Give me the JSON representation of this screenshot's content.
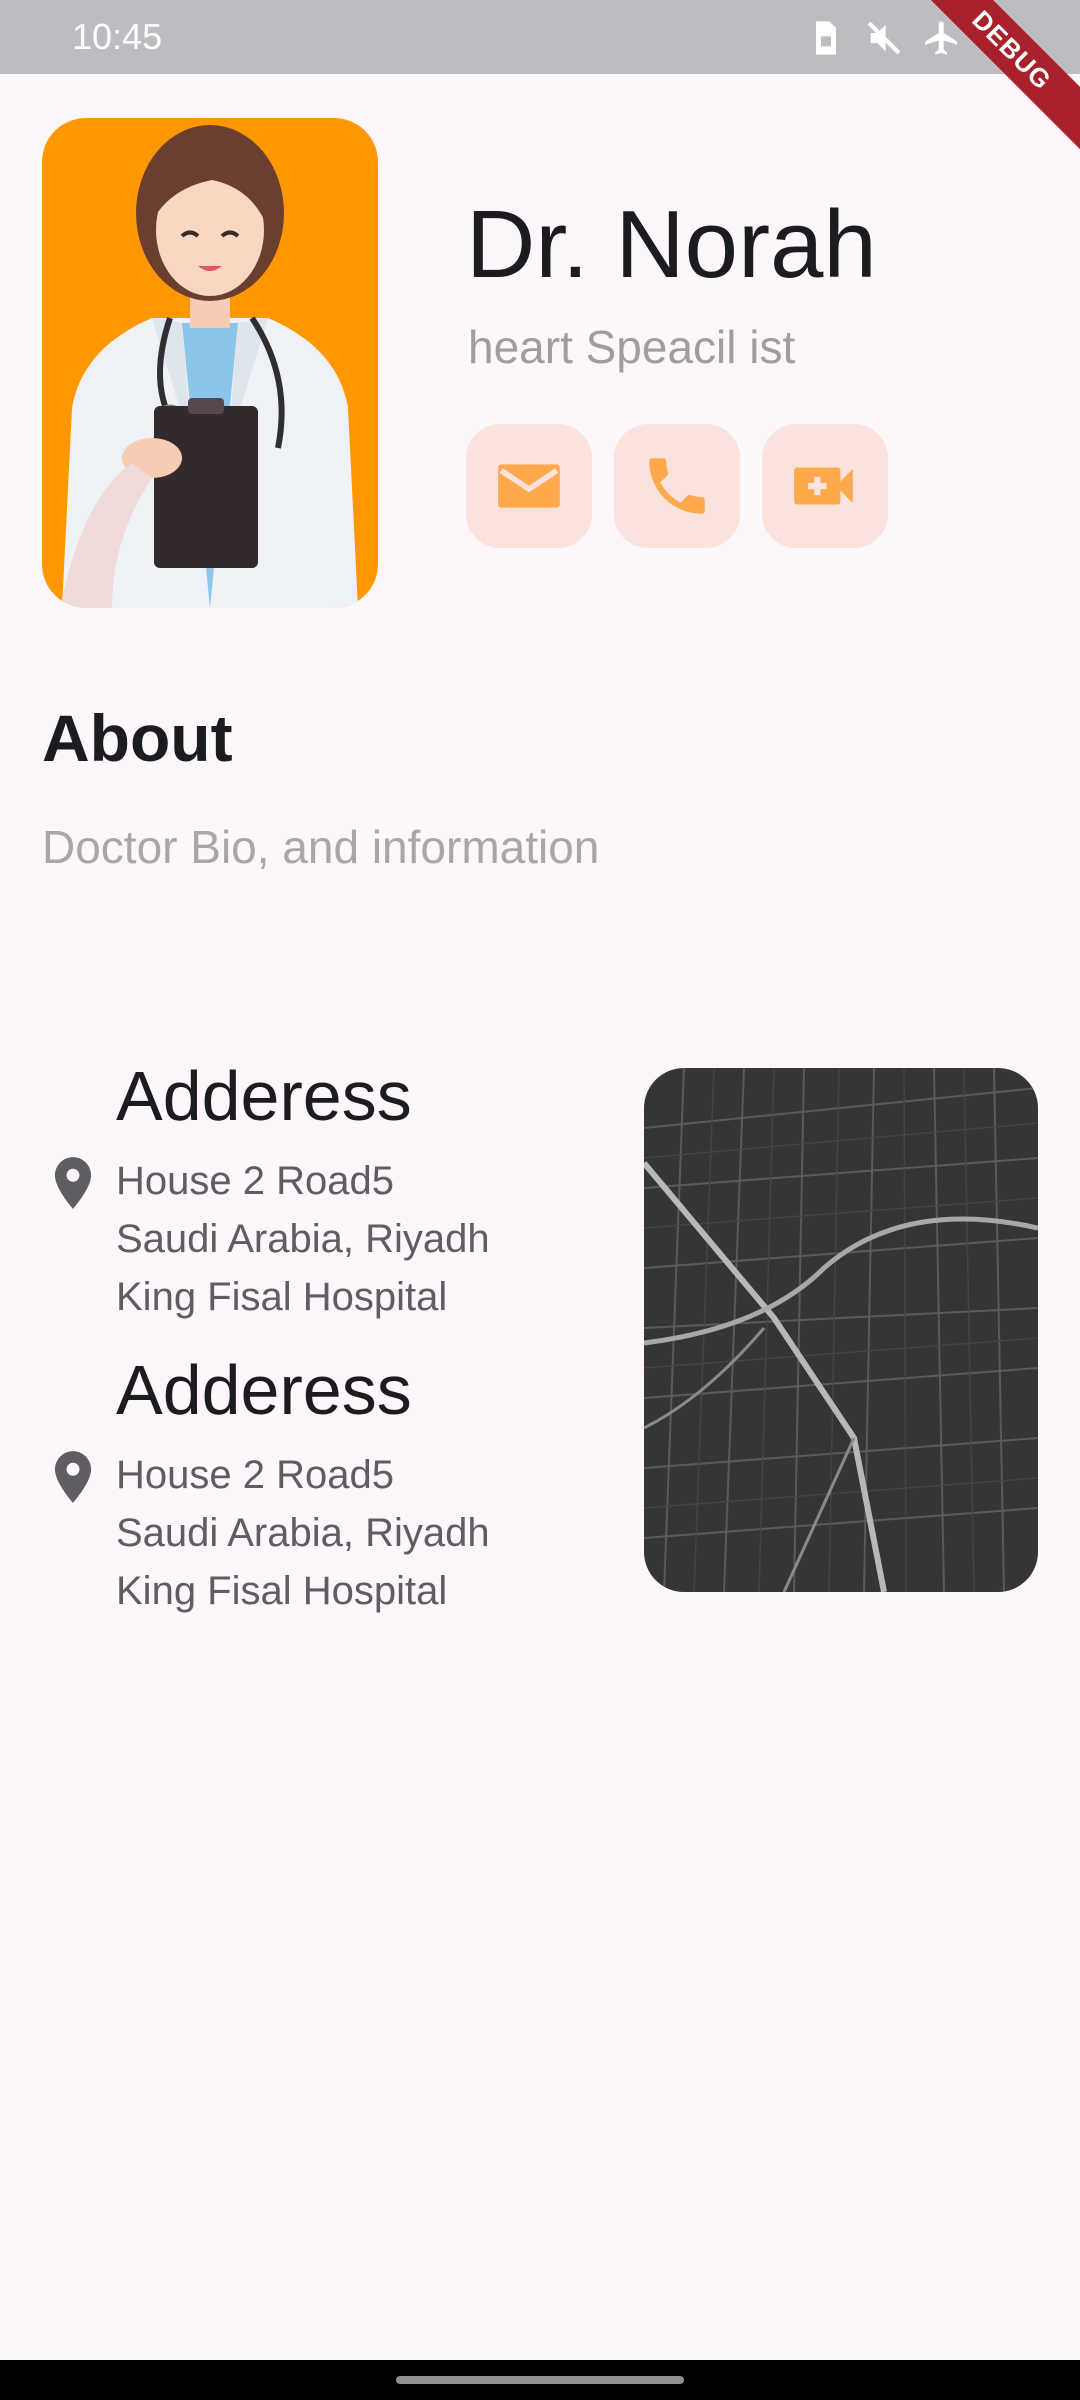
{
  "status_bar": {
    "time": "10:45",
    "icons": [
      "sim-icon",
      "mute-icon",
      "airplane-icon",
      "battery-charging-icon"
    ],
    "debug_label": "DEBUG"
  },
  "profile": {
    "name": "Dr. Norah",
    "specialty": "heart Speacil ist",
    "avatar_bg": "#ff9800",
    "actions": [
      {
        "icon": "mail-icon"
      },
      {
        "icon": "phone-icon"
      },
      {
        "icon": "video-call-icon"
      }
    ],
    "accent": "#ffa94d"
  },
  "about": {
    "title": "About",
    "bio": "Doctor Bio, and information"
  },
  "addresses": [
    {
      "title": "Adderess",
      "line1": "House 2 Road5",
      "line2": "Saudi Arabia, Riyadh",
      "line3": "King Fisal Hospital"
    },
    {
      "title": "Adderess",
      "line1": "House 2 Road5",
      "line2": "Saudi Arabia, Riyadh",
      "line3": "King Fisal Hospital"
    }
  ]
}
